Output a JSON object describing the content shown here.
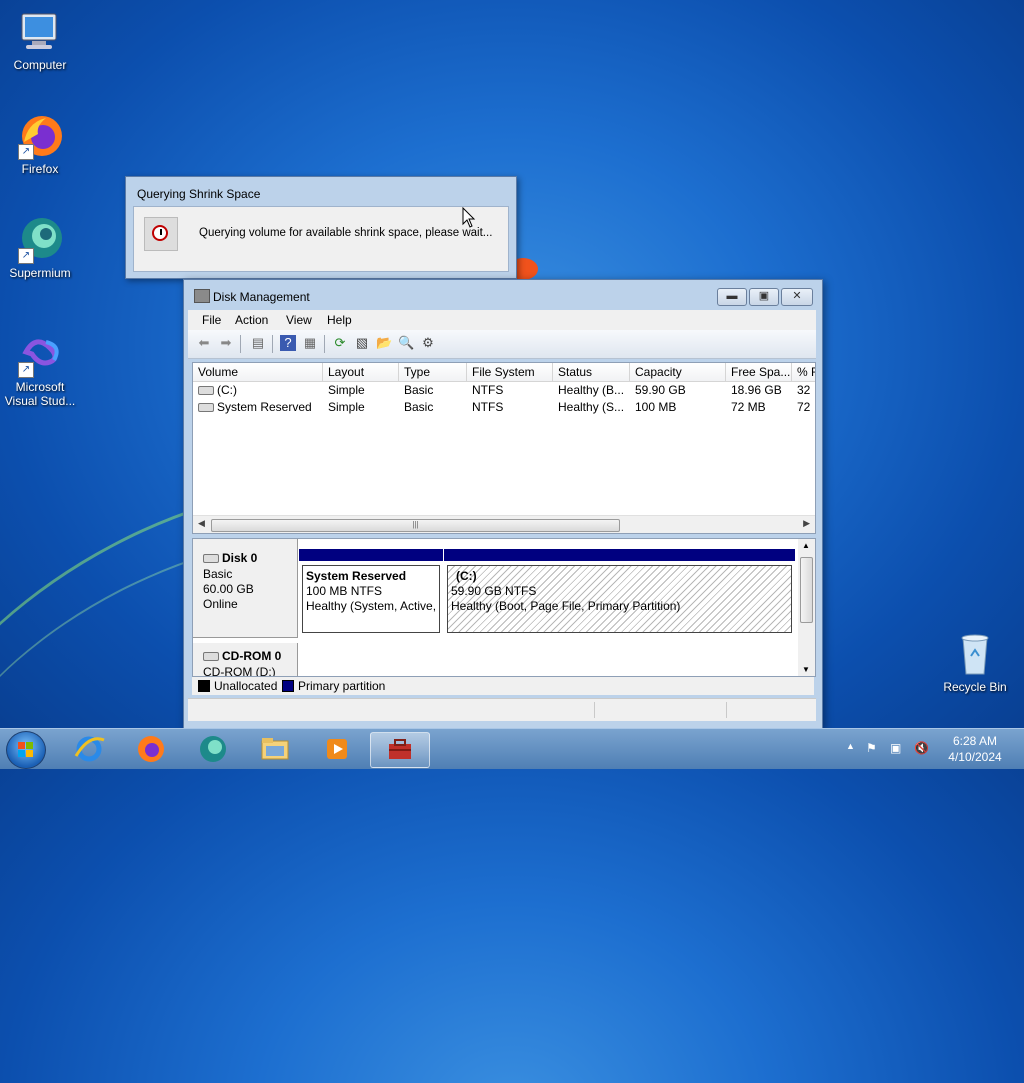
{
  "desktop": {
    "icons": [
      {
        "label": "Computer"
      },
      {
        "label": "Firefox"
      },
      {
        "label": "Supermium"
      },
      {
        "label": "Microsoft Visual Stud..."
      },
      {
        "label": "Recycle Bin"
      }
    ]
  },
  "dialog": {
    "title": "Querying Shrink Space",
    "message": "Querying volume for available shrink space, please wait..."
  },
  "window": {
    "title": "Disk Management",
    "menu": [
      "File",
      "Action",
      "View",
      "Help"
    ],
    "columns": [
      "Volume",
      "Layout",
      "Type",
      "File System",
      "Status",
      "Capacity",
      "Free Spa...",
      "% F"
    ],
    "rows": [
      [
        "(C:)",
        "Simple",
        "Basic",
        "NTFS",
        "Healthy (B...",
        "59.90 GB",
        "18.96 GB",
        "32"
      ],
      [
        "System Reserved",
        "Simple",
        "Basic",
        "NTFS",
        "Healthy (S...",
        "100 MB",
        "72 MB",
        "72"
      ]
    ],
    "disk0": {
      "name": "Disk 0",
      "type": "Basic",
      "size": "60.00 GB",
      "state": "Online",
      "partitions": [
        {
          "name": "System Reserved",
          "size": "100 MB NTFS",
          "status": "Healthy (System, Active,"
        },
        {
          "name": "(C:)",
          "size": "59.90 GB NTFS",
          "status": "Healthy (Boot, Page File, Primary Partition)"
        }
      ]
    },
    "cdrom": {
      "name": "CD-ROM 0",
      "sub": "CD-ROM (D:)"
    },
    "legend": [
      {
        "label": "Unallocated",
        "color": "#000000"
      },
      {
        "label": "Primary partition",
        "color": "#000080"
      }
    ]
  },
  "taskbar": {
    "time": "6:28 AM",
    "date": "4/10/2024"
  }
}
